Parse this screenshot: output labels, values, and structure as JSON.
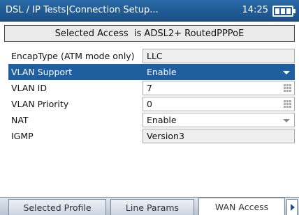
{
  "header": {
    "title": "DSL / IP Tests|Connection Setup...",
    "time": "14:25",
    "battery_icon": "battery-icon"
  },
  "status": {
    "text": "Selected Access  is ADSL2+ RoutedPPPoE"
  },
  "form": {
    "rows": [
      {
        "label": "EncapType (ATM mode only)",
        "value": "LLC",
        "control": "readonly"
      },
      {
        "label": "VLAN Support",
        "value": "Enable",
        "control": "dropdown",
        "selected": true
      },
      {
        "label": "VLAN ID",
        "value": "7",
        "control": "keypad"
      },
      {
        "label": "VLAN Priority",
        "value": "0",
        "control": "keypad"
      },
      {
        "label": "NAT",
        "value": "Enable",
        "control": "dropdown"
      },
      {
        "label": "IGMP",
        "value": "Version3",
        "control": "readonly"
      }
    ]
  },
  "tabs": [
    {
      "label": "Selected Profile",
      "active": false
    },
    {
      "label": "Line Params",
      "active": false
    },
    {
      "label": "WAN Access",
      "active": true
    }
  ],
  "colors": {
    "title_bar": "#1f5fa0",
    "selection": "#1f5fa0"
  }
}
